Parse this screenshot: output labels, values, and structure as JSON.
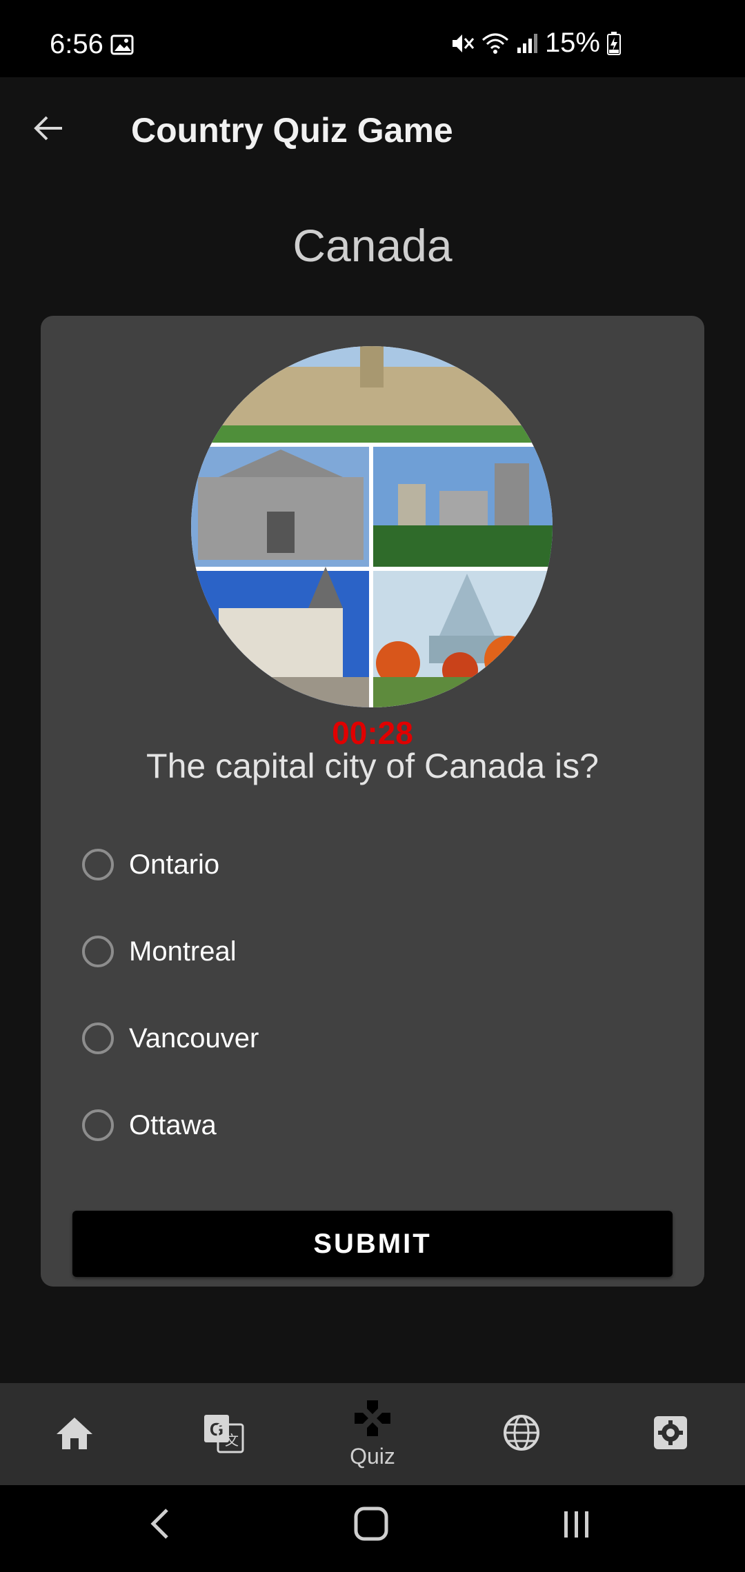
{
  "status_bar": {
    "time": "6:56",
    "battery": "15%",
    "icons": [
      "image-notification-icon",
      "mute-icon",
      "wifi-icon",
      "signal-icon",
      "battery-charging-icon"
    ]
  },
  "app_bar": {
    "title": "Country Quiz Game",
    "back_icon": "arrow-back-icon"
  },
  "country": "Canada",
  "quiz": {
    "timer": "00:28",
    "question": "The capital city of Canada is?",
    "options": [
      "Ontario",
      "Montreal",
      "Vancouver",
      "Ottawa"
    ],
    "submit_label": "SUBMIT"
  },
  "bottom_nav": {
    "items": [
      {
        "icon": "home-icon",
        "label": ""
      },
      {
        "icon": "translate-icon",
        "label": ""
      },
      {
        "icon": "gamepad-icon",
        "label": "Quiz"
      },
      {
        "icon": "globe-icon",
        "label": ""
      },
      {
        "icon": "settings-icon",
        "label": ""
      }
    ]
  },
  "colors": {
    "background": "#121212",
    "card": "#414141",
    "timer": "#e00000",
    "nav_bar": "#2e2e2e"
  }
}
